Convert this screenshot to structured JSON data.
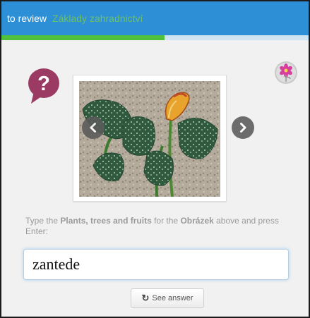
{
  "header": {
    "title": "to review",
    "course": "Základy zahradnictví",
    "progress_fraction": 0.53
  },
  "colors": {
    "header_bg": "#2d8fd5",
    "progress_fill": "#4fc13a",
    "course_text": "#6cc06a",
    "mem_bubble": "#9b3b63"
  },
  "icons": {
    "mem": "question-bubble-icon",
    "settings": "flower-icon",
    "prev": "chevron-left-icon",
    "next": "chevron-right-icon",
    "refresh": "refresh-icon"
  },
  "prompt": {
    "prefix": "Type the ",
    "category": "Plants, trees and fruits",
    "middle": " for the ",
    "item_type": "Obrázek",
    "suffix": " above and press Enter:"
  },
  "answer": {
    "value": "zantede"
  },
  "see_answer": {
    "label": "See answer"
  }
}
